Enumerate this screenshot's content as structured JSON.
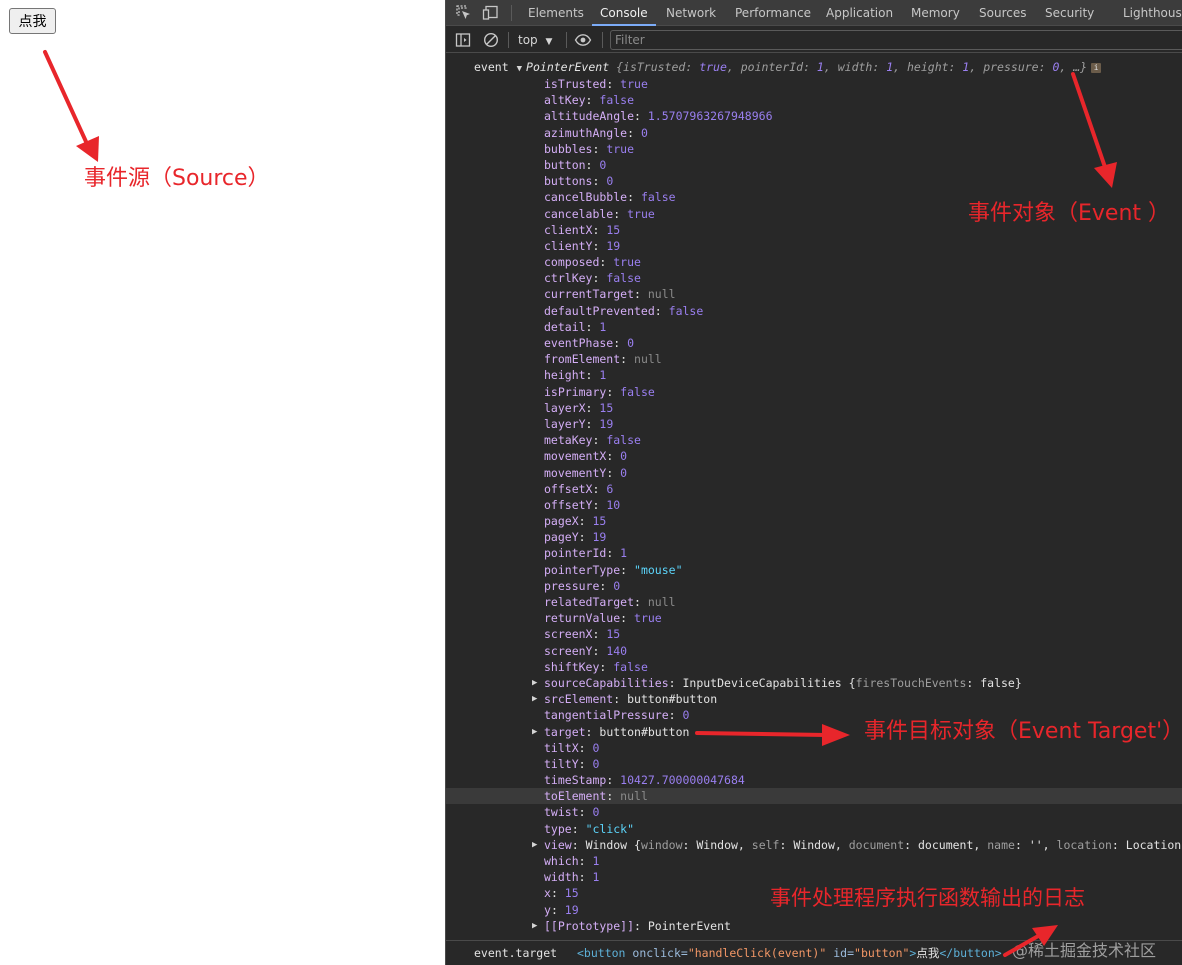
{
  "page": {
    "button_label": "点我"
  },
  "annotations": {
    "source": "事件源（Source）",
    "event_object": "事件对象（Event ）",
    "event_target": "事件目标对象（Event Target'）",
    "handler_log": "事件处理程序执行函数输出的日志"
  },
  "watermark": "@稀土掘金技术社区",
  "devtools": {
    "tabs": [
      "Elements",
      "Console",
      "Network",
      "Performance",
      "Application",
      "Memory",
      "Sources",
      "Security",
      "Lighthouse"
    ],
    "active_tab": "Console",
    "context": "top",
    "filter_placeholder": "Filter",
    "icons": [
      "inspect-icon",
      "device-toggle-icon",
      "sidebar-icon",
      "clear-console-icon",
      "dropdown-caret-icon",
      "eye-icon",
      "info-icon"
    ]
  },
  "console": {
    "log_label": "event",
    "class_name": "PointerEvent",
    "preview": {
      "open": "{",
      "items": [
        {
          "k": "isTrusted",
          "v": "true"
        },
        {
          "k": "pointerId",
          "v": "1"
        },
        {
          "k": "width",
          "v": "1"
        },
        {
          "k": "height",
          "v": "1"
        },
        {
          "k": "pressure",
          "v": "0"
        }
      ],
      "close": "…}"
    },
    "info_badge": "i",
    "properties": [
      {
        "key": "isTrusted",
        "value": "true",
        "type": "bool"
      },
      {
        "key": "altKey",
        "value": "false",
        "type": "bool"
      },
      {
        "key": "altitudeAngle",
        "value": "1.5707963267948966",
        "type": "num"
      },
      {
        "key": "azimuthAngle",
        "value": "0",
        "type": "num"
      },
      {
        "key": "bubbles",
        "value": "true",
        "type": "bool"
      },
      {
        "key": "button",
        "value": "0",
        "type": "num"
      },
      {
        "key": "buttons",
        "value": "0",
        "type": "num"
      },
      {
        "key": "cancelBubble",
        "value": "false",
        "type": "bool"
      },
      {
        "key": "cancelable",
        "value": "true",
        "type": "bool"
      },
      {
        "key": "clientX",
        "value": "15",
        "type": "num"
      },
      {
        "key": "clientY",
        "value": "19",
        "type": "num"
      },
      {
        "key": "composed",
        "value": "true",
        "type": "bool"
      },
      {
        "key": "ctrlKey",
        "value": "false",
        "type": "bool"
      },
      {
        "key": "currentTarget",
        "value": "null",
        "type": "null"
      },
      {
        "key": "defaultPrevented",
        "value": "false",
        "type": "bool"
      },
      {
        "key": "detail",
        "value": "1",
        "type": "num"
      },
      {
        "key": "eventPhase",
        "value": "0",
        "type": "num"
      },
      {
        "key": "fromElement",
        "value": "null",
        "type": "null"
      },
      {
        "key": "height",
        "value": "1",
        "type": "num"
      },
      {
        "key": "isPrimary",
        "value": "false",
        "type": "bool"
      },
      {
        "key": "layerX",
        "value": "15",
        "type": "num"
      },
      {
        "key": "layerY",
        "value": "19",
        "type": "num"
      },
      {
        "key": "metaKey",
        "value": "false",
        "type": "bool"
      },
      {
        "key": "movementX",
        "value": "0",
        "type": "num"
      },
      {
        "key": "movementY",
        "value": "0",
        "type": "num"
      },
      {
        "key": "offsetX",
        "value": "6",
        "type": "num"
      },
      {
        "key": "offsetY",
        "value": "10",
        "type": "num"
      },
      {
        "key": "pageX",
        "value": "15",
        "type": "num"
      },
      {
        "key": "pageY",
        "value": "19",
        "type": "num"
      },
      {
        "key": "pointerId",
        "value": "1",
        "type": "num"
      },
      {
        "key": "pointerType",
        "value": "\"mouse\"",
        "type": "str"
      },
      {
        "key": "pressure",
        "value": "0",
        "type": "num"
      },
      {
        "key": "relatedTarget",
        "value": "null",
        "type": "null"
      },
      {
        "key": "returnValue",
        "value": "true",
        "type": "bool"
      },
      {
        "key": "screenX",
        "value": "15",
        "type": "num"
      },
      {
        "key": "screenY",
        "value": "140",
        "type": "num"
      },
      {
        "key": "shiftKey",
        "value": "false",
        "type": "bool"
      },
      {
        "key": "sourceCapabilities",
        "value": "InputDeviceCapabilities",
        "type": "obj",
        "expandable": true,
        "preview": [
          {
            "k": "firesTouchEvents",
            "v": "false"
          }
        ],
        "preview_close": "}"
      },
      {
        "key": "srcElement",
        "value": "button#button",
        "type": "obj",
        "expandable": true
      },
      {
        "key": "tangentialPressure",
        "value": "0",
        "type": "num"
      },
      {
        "key": "target",
        "value": "button#button",
        "type": "obj",
        "expandable": true
      },
      {
        "key": "tiltX",
        "value": "0",
        "type": "num"
      },
      {
        "key": "tiltY",
        "value": "0",
        "type": "num"
      },
      {
        "key": "timeStamp",
        "value": "10427.700000047684",
        "type": "num"
      },
      {
        "key": "toElement",
        "value": "null",
        "type": "null",
        "highlight": true
      },
      {
        "key": "twist",
        "value": "0",
        "type": "num"
      },
      {
        "key": "type",
        "value": "\"click\"",
        "type": "str"
      },
      {
        "key": "view",
        "value": "Window",
        "type": "obj",
        "expandable": true,
        "preview": [
          {
            "k": "window",
            "v": "Window"
          },
          {
            "k": "self",
            "v": "Window"
          },
          {
            "k": "document",
            "v": "document"
          },
          {
            "k": "name",
            "v": "''"
          },
          {
            "k": "location",
            "v": "Location"
          }
        ],
        "preview_close": "…}"
      },
      {
        "key": "which",
        "value": "1",
        "type": "num"
      },
      {
        "key": "width",
        "value": "1",
        "type": "num"
      },
      {
        "key": "x",
        "value": "15",
        "type": "num"
      },
      {
        "key": "y",
        "value": "19",
        "type": "num"
      },
      {
        "key": "[[Prototype]]",
        "value": "PointerEvent",
        "type": "obj",
        "expandable": true
      }
    ],
    "footer": {
      "label": "event.target",
      "html_open_tag": "<button",
      "attrs": [
        {
          "name": "onclick",
          "value": "\"handleClick(event)\""
        },
        {
          "name": "id",
          "value": "\"button\""
        }
      ],
      "html_tag_end": ">",
      "html_text": "点我",
      "html_close_tag": "</button>"
    }
  },
  "colors": {
    "annotation_red": "#e8262b",
    "devtools_bg": "#282828",
    "active_tab_underline": "#7cacf8"
  }
}
